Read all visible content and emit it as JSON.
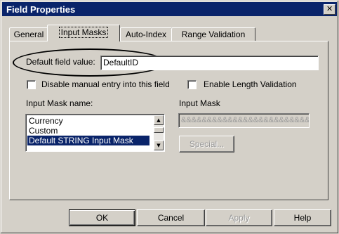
{
  "window": {
    "title": "Field Properties"
  },
  "tabs": [
    {
      "label": "General"
    },
    {
      "label": "Input Masks"
    },
    {
      "label": "Auto-Index"
    },
    {
      "label": "Range Validation"
    }
  ],
  "default_field": {
    "label": "Default field value:",
    "value": "DefaultID"
  },
  "checkboxes": {
    "disable_manual": "Disable manual entry into this field",
    "enable_length": "Enable Length Validation"
  },
  "mask_name": {
    "label": "Input Mask name:",
    "items": [
      "Currency",
      "Custom",
      "Default STRING Input Mask",
      "..."
    ],
    "selected": "Default STRING Input Mask"
  },
  "input_mask": {
    "label": "Input Mask",
    "value": "&&&&&&&&&&&&&&&&&&&&&&&&&&",
    "special_label": "Special..."
  },
  "buttons": {
    "ok": "OK",
    "cancel": "Cancel",
    "apply": "Apply",
    "help": "Help"
  }
}
